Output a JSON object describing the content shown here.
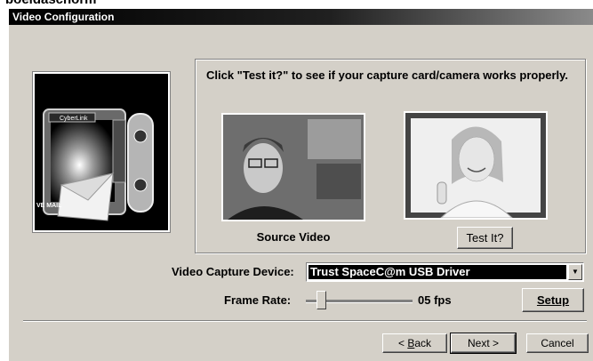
{
  "page_top_text": "boeidaschorm",
  "window": {
    "title": "Video Configuration"
  },
  "instructions": "Click  \"Test it?\" to see if your capture card/camera works properly.",
  "art": {
    "brand": "CyberLink",
    "caption": "VE MAIL"
  },
  "preview": {
    "source_label": "Source Video",
    "test_button": "Test It?"
  },
  "capture_device": {
    "label": "Video Capture Device:",
    "value": "Trust SpaceC@m USB Driver"
  },
  "frame_rate": {
    "label": "Frame Rate:",
    "value": "05 fps",
    "setup_button": "Setup"
  },
  "nav": {
    "back_mnemonic": "B",
    "back_rest": "ack",
    "back_prefix": "< ",
    "next": "Next >",
    "cancel": "Cancel"
  },
  "colors": {
    "titlebar": "#000000",
    "face": "#d4d0c8",
    "highlight": "#000000"
  }
}
